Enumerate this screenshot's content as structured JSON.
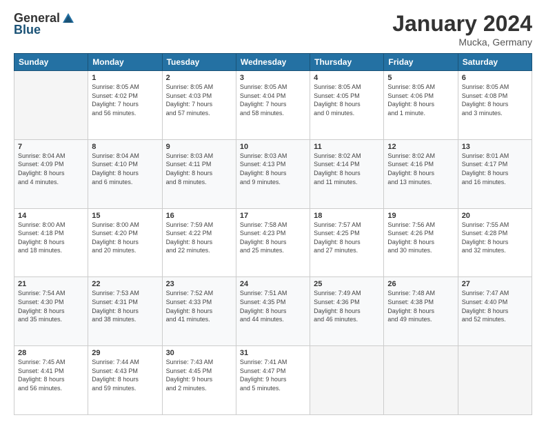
{
  "logo": {
    "general": "General",
    "blue": "Blue"
  },
  "header": {
    "month": "January 2024",
    "location": "Mucka, Germany"
  },
  "days_of_week": [
    "Sunday",
    "Monday",
    "Tuesday",
    "Wednesday",
    "Thursday",
    "Friday",
    "Saturday"
  ],
  "weeks": [
    [
      {
        "day": "",
        "info": ""
      },
      {
        "day": "1",
        "info": "Sunrise: 8:05 AM\nSunset: 4:02 PM\nDaylight: 7 hours\nand 56 minutes."
      },
      {
        "day": "2",
        "info": "Sunrise: 8:05 AM\nSunset: 4:03 PM\nDaylight: 7 hours\nand 57 minutes."
      },
      {
        "day": "3",
        "info": "Sunrise: 8:05 AM\nSunset: 4:04 PM\nDaylight: 7 hours\nand 58 minutes."
      },
      {
        "day": "4",
        "info": "Sunrise: 8:05 AM\nSunset: 4:05 PM\nDaylight: 8 hours\nand 0 minutes."
      },
      {
        "day": "5",
        "info": "Sunrise: 8:05 AM\nSunset: 4:06 PM\nDaylight: 8 hours\nand 1 minute."
      },
      {
        "day": "6",
        "info": "Sunrise: 8:05 AM\nSunset: 4:08 PM\nDaylight: 8 hours\nand 3 minutes."
      }
    ],
    [
      {
        "day": "7",
        "info": "Sunrise: 8:04 AM\nSunset: 4:09 PM\nDaylight: 8 hours\nand 4 minutes."
      },
      {
        "day": "8",
        "info": "Sunrise: 8:04 AM\nSunset: 4:10 PM\nDaylight: 8 hours\nand 6 minutes."
      },
      {
        "day": "9",
        "info": "Sunrise: 8:03 AM\nSunset: 4:11 PM\nDaylight: 8 hours\nand 8 minutes."
      },
      {
        "day": "10",
        "info": "Sunrise: 8:03 AM\nSunset: 4:13 PM\nDaylight: 8 hours\nand 9 minutes."
      },
      {
        "day": "11",
        "info": "Sunrise: 8:02 AM\nSunset: 4:14 PM\nDaylight: 8 hours\nand 11 minutes."
      },
      {
        "day": "12",
        "info": "Sunrise: 8:02 AM\nSunset: 4:16 PM\nDaylight: 8 hours\nand 13 minutes."
      },
      {
        "day": "13",
        "info": "Sunrise: 8:01 AM\nSunset: 4:17 PM\nDaylight: 8 hours\nand 16 minutes."
      }
    ],
    [
      {
        "day": "14",
        "info": "Sunrise: 8:00 AM\nSunset: 4:18 PM\nDaylight: 8 hours\nand 18 minutes."
      },
      {
        "day": "15",
        "info": "Sunrise: 8:00 AM\nSunset: 4:20 PM\nDaylight: 8 hours\nand 20 minutes."
      },
      {
        "day": "16",
        "info": "Sunrise: 7:59 AM\nSunset: 4:22 PM\nDaylight: 8 hours\nand 22 minutes."
      },
      {
        "day": "17",
        "info": "Sunrise: 7:58 AM\nSunset: 4:23 PM\nDaylight: 8 hours\nand 25 minutes."
      },
      {
        "day": "18",
        "info": "Sunrise: 7:57 AM\nSunset: 4:25 PM\nDaylight: 8 hours\nand 27 minutes."
      },
      {
        "day": "19",
        "info": "Sunrise: 7:56 AM\nSunset: 4:26 PM\nDaylight: 8 hours\nand 30 minutes."
      },
      {
        "day": "20",
        "info": "Sunrise: 7:55 AM\nSunset: 4:28 PM\nDaylight: 8 hours\nand 32 minutes."
      }
    ],
    [
      {
        "day": "21",
        "info": "Sunrise: 7:54 AM\nSunset: 4:30 PM\nDaylight: 8 hours\nand 35 minutes."
      },
      {
        "day": "22",
        "info": "Sunrise: 7:53 AM\nSunset: 4:31 PM\nDaylight: 8 hours\nand 38 minutes."
      },
      {
        "day": "23",
        "info": "Sunrise: 7:52 AM\nSunset: 4:33 PM\nDaylight: 8 hours\nand 41 minutes."
      },
      {
        "day": "24",
        "info": "Sunrise: 7:51 AM\nSunset: 4:35 PM\nDaylight: 8 hours\nand 44 minutes."
      },
      {
        "day": "25",
        "info": "Sunrise: 7:49 AM\nSunset: 4:36 PM\nDaylight: 8 hours\nand 46 minutes."
      },
      {
        "day": "26",
        "info": "Sunrise: 7:48 AM\nSunset: 4:38 PM\nDaylight: 8 hours\nand 49 minutes."
      },
      {
        "day": "27",
        "info": "Sunrise: 7:47 AM\nSunset: 4:40 PM\nDaylight: 8 hours\nand 52 minutes."
      }
    ],
    [
      {
        "day": "28",
        "info": "Sunrise: 7:45 AM\nSunset: 4:41 PM\nDaylight: 8 hours\nand 56 minutes."
      },
      {
        "day": "29",
        "info": "Sunrise: 7:44 AM\nSunset: 4:43 PM\nDaylight: 8 hours\nand 59 minutes."
      },
      {
        "day": "30",
        "info": "Sunrise: 7:43 AM\nSunset: 4:45 PM\nDaylight: 9 hours\nand 2 minutes."
      },
      {
        "day": "31",
        "info": "Sunrise: 7:41 AM\nSunset: 4:47 PM\nDaylight: 9 hours\nand 5 minutes."
      },
      {
        "day": "",
        "info": ""
      },
      {
        "day": "",
        "info": ""
      },
      {
        "day": "",
        "info": ""
      }
    ]
  ]
}
